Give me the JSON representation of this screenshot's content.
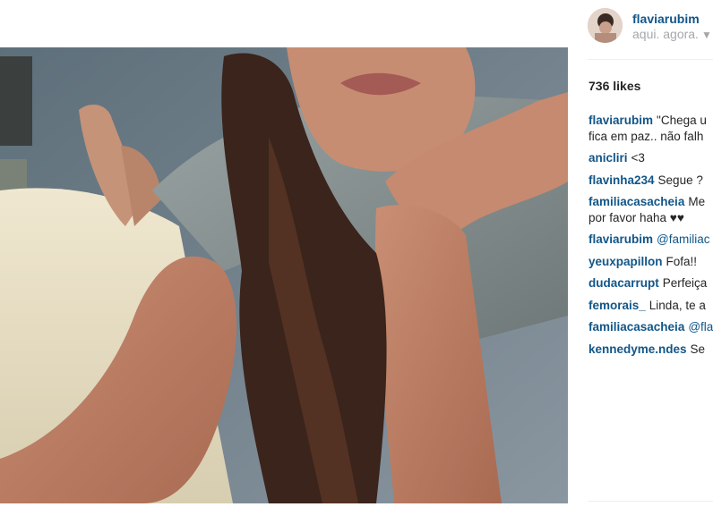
{
  "post": {
    "author": {
      "username": "flaviarubim",
      "location": "aqui. agora.",
      "location_icon": "location-pin-icon"
    },
    "likes": "736 likes",
    "comments": [
      {
        "user": "flaviarubim",
        "text": "\"Chega u",
        "text2": "fica em paz.. não falh"
      },
      {
        "user": "anicliri",
        "text": "<3"
      },
      {
        "user": "flavinha234",
        "text": "Segue ?"
      },
      {
        "user": "familiacasacheia",
        "text": "Me",
        "text2": "por favor haha ♥♥"
      },
      {
        "user": "flaviarubim",
        "mention": "@familiac"
      },
      {
        "user": "yeuxpapillon",
        "text": "Fofa!!"
      },
      {
        "user": "dudacarrupt",
        "text": "Perfeiça"
      },
      {
        "user": "femorais_",
        "text": "Linda, te a"
      },
      {
        "user": "familiacasacheia",
        "mention": "@fla"
      },
      {
        "user": "kennedyme.ndes",
        "text": "Se"
      }
    ]
  },
  "colors": {
    "username": "#125688",
    "muted": "#a5a7aa",
    "text": "#262626"
  }
}
